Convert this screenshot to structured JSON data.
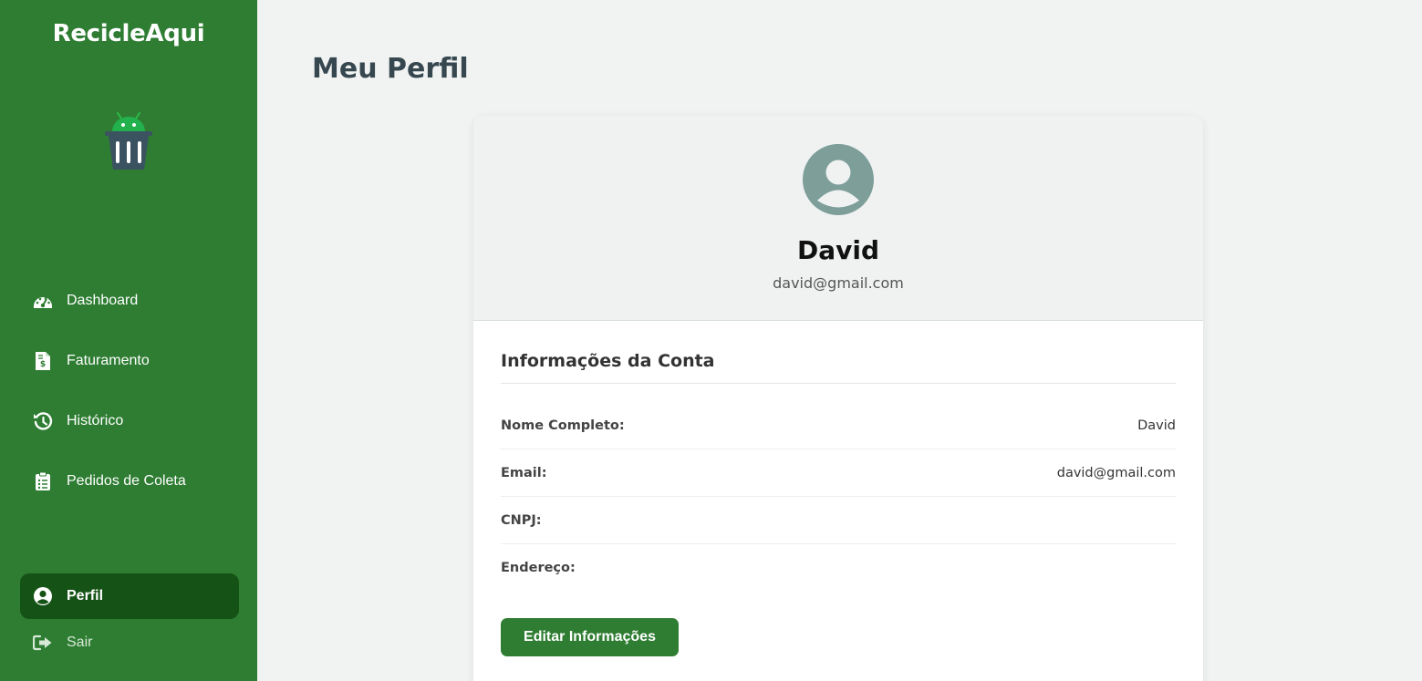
{
  "sidebar": {
    "brand": "RecicleAqui",
    "items": [
      {
        "label": "Dashboard",
        "icon": "gauge-icon"
      },
      {
        "label": "Faturamento",
        "icon": "invoice-dollar-icon"
      },
      {
        "label": "Histórico",
        "icon": "history-icon"
      },
      {
        "label": "Pedidos de Coleta",
        "icon": "clipboard-list-icon"
      }
    ],
    "profile": {
      "label": "Perfil",
      "icon": "user-circle-icon"
    },
    "logout": {
      "label": "Sair",
      "icon": "sign-out-icon"
    }
  },
  "page": {
    "title": "Meu Perfil"
  },
  "profile": {
    "name": "David",
    "email": "david@gmail.com",
    "section_title": "Informações da Conta",
    "fields": [
      {
        "label": "Nome Completo:",
        "value": "David"
      },
      {
        "label": "Email:",
        "value": "david@gmail.com"
      },
      {
        "label": "CNPJ:",
        "value": ""
      },
      {
        "label": "Endereço:",
        "value": ""
      }
    ],
    "edit_button": "Editar Informações"
  },
  "colors": {
    "sidebar_bg": "#2e7d32",
    "sidebar_active": "#155215",
    "page_bg": "#f0f3f2",
    "avatar": "#7d9e99",
    "primary_button": "#2e7d32"
  }
}
